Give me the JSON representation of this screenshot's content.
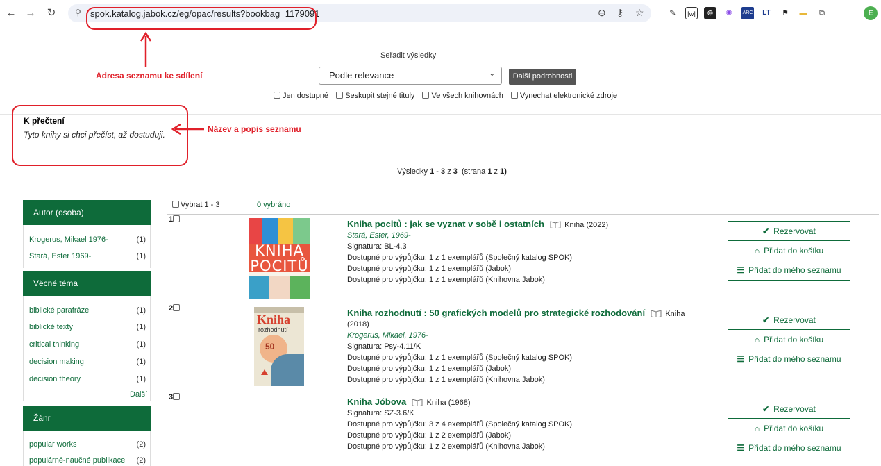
{
  "browser": {
    "url": "spok.katalog.jabok.cz/eg/opac/results?bookbag=1179091",
    "profile_initial": "E"
  },
  "sort": {
    "title": "Seřadit výsledky",
    "selected": "Podle relevance",
    "details_button": "Další podrobnosti",
    "filters": [
      "Jen dostupné",
      "Seskupit stejné tituly",
      "Ve všech knihovnách",
      "Vynechat elektronické zdroje"
    ]
  },
  "list": {
    "name": "K přečtení",
    "description": "Tyto knihy si chci přečíst, až dostuduji."
  },
  "annotations": {
    "url_note": "Adresa seznamu ke sdílení",
    "title_note": "Název a popis seznamu"
  },
  "results": {
    "prefix": "Výsledky",
    "from": "1",
    "dash": "-",
    "to": "3",
    "z": "z",
    "total": "3",
    "page_label": "(strana",
    "page": "1",
    "page_z": "z",
    "pages": "1)",
    "select_all": "Vybrat 1 - 3",
    "selected": "0 vybráno"
  },
  "facets": {
    "author": {
      "title": "Autor (osoba)",
      "items": [
        {
          "label": "Krogerus, Mikael 1976-",
          "count": "(1)"
        },
        {
          "label": "Stará, Ester 1969-",
          "count": "(1)"
        }
      ]
    },
    "subject": {
      "title": "Věcné téma",
      "items": [
        {
          "label": "biblické parafráze",
          "count": "(1)"
        },
        {
          "label": "biblické texty",
          "count": "(1)"
        },
        {
          "label": "critical thinking",
          "count": "(1)"
        },
        {
          "label": "decision making",
          "count": "(1)"
        },
        {
          "label": "decision theory",
          "count": "(1)"
        }
      ],
      "more": "Další"
    },
    "genre": {
      "title": "Žánr",
      "items": [
        {
          "label": "popular works",
          "count": "(2)"
        },
        {
          "label": "populárně-naučné publikace",
          "count": "(2)"
        }
      ]
    }
  },
  "records": [
    {
      "num": "1",
      "title": "Kniha pocitů : jak se vyznat v sobě i ostatních",
      "format": "Kniha (2022)",
      "author": "Stará, Ester, 1969-",
      "callnumber": "Signatura: BL-4.3",
      "holdings": [
        "Dostupné pro výpůjčku: 1 z 1 exemplářů (Společný katalog SPOK)",
        "Dostupné pro výpůjčku: 1 z 1 exemplářů (Jabok)",
        "Dostupné pro výpůjčku: 1 z 1 exemplářů (Knihovna Jabok)"
      ],
      "cover_text": [
        "KNIHA",
        "POCITŮ"
      ]
    },
    {
      "num": "2",
      "title": "Kniha rozhodnutí : 50 grafických modelů pro strategické rozhodování",
      "format": "Kniha",
      "year": "(2018)",
      "author": "Krogerus, Mikael, 1976-",
      "callnumber": "Signatura: Psy-4.11/K",
      "holdings": [
        "Dostupné pro výpůjčku: 1 z 1 exemplářů (Společný katalog SPOK)",
        "Dostupné pro výpůjčku: 1 z 1 exemplářů (Jabok)",
        "Dostupné pro výpůjčku: 1 z 1 exemplářů (Knihovna Jabok)"
      ],
      "cover_text": [
        "Kniha",
        "rozhodnutí",
        "50"
      ]
    },
    {
      "num": "3",
      "title": "Kniha Jóbova",
      "format": "Kniha (1968)",
      "callnumber": "Signatura: SZ-3.6/K",
      "holdings": [
        "Dostupné pro výpůjčku: 3 z 4 exemplářů (Společný katalog SPOK)",
        "Dostupné pro výpůjčku: 1 z 2 exemplářů (Jabok)",
        "Dostupné pro výpůjčku: 1 z 2 exemplářů (Knihovna Jabok)"
      ]
    }
  ],
  "actions": {
    "reserve": "Rezervovat",
    "cart": "Přidat do košíku",
    "my_list": "Přidat do mého seznamu"
  },
  "colors": {
    "accent": "#0e6b3a",
    "annotation": "#e0202a"
  }
}
